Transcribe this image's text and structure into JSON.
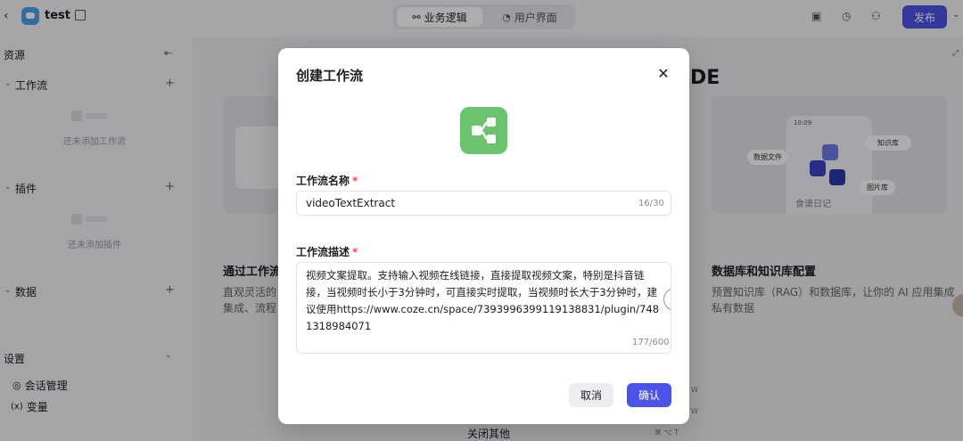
{
  "app": {
    "name": "test"
  },
  "tabs": [
    {
      "label": "业务逻辑",
      "glyph": "⚯"
    },
    {
      "label": "用户界面",
      "glyph": "◔"
    }
  ],
  "publish_label": "发布",
  "sidebar": {
    "title": "资源",
    "sections": [
      {
        "label": "工作流",
        "empty": "还未添加工作流"
      },
      {
        "label": "插件",
        "empty": "还未添加插件"
      },
      {
        "label": "数据"
      }
    ],
    "settings": {
      "label": "设置",
      "items": [
        {
          "label": "会话管理",
          "icon": "chat-icon"
        },
        {
          "label": "变量",
          "glyph": "(x)"
        }
      ]
    }
  },
  "background": {
    "title_tail": "DE",
    "card_left": {
      "title": "通过工作流",
      "desc_line1": "直观灵活的",
      "desc_line2": "集成、流程"
    },
    "card_right": {
      "title": "数据库和知识库配置",
      "desc_line1": "预置知识库（RAG）和数据库，让你的 AI 应用集成",
      "desc_line2": "私有数据",
      "tags": [
        "数据文件",
        "知识库",
        "图片库",
        "食谱日记",
        "10:09"
      ]
    },
    "below_menu": "关闭其他"
  },
  "modal": {
    "title": "创建工作流",
    "name_label": "工作流名称",
    "name_value": "videoTextExtract",
    "name_counter": "16/30",
    "desc_label": "工作流描述",
    "desc_value": "视频文案提取。支持输入视频在线链接，直接提取视频文案，特别是抖音链接，当视频时长小于3分钟时，可直接实时提取，当视频时长大于3分钟时，建议使用https://www.coze.cn/space/7393996399119138831/plugin/7481318984071",
    "desc_counter": "177/600",
    "required_mark": "*",
    "cancel_label": "取消",
    "confirm_label": "确认"
  },
  "colors": {
    "accent": "#4d53e8",
    "workflow_icon": "#6cc36f",
    "required": "#e5484d"
  }
}
